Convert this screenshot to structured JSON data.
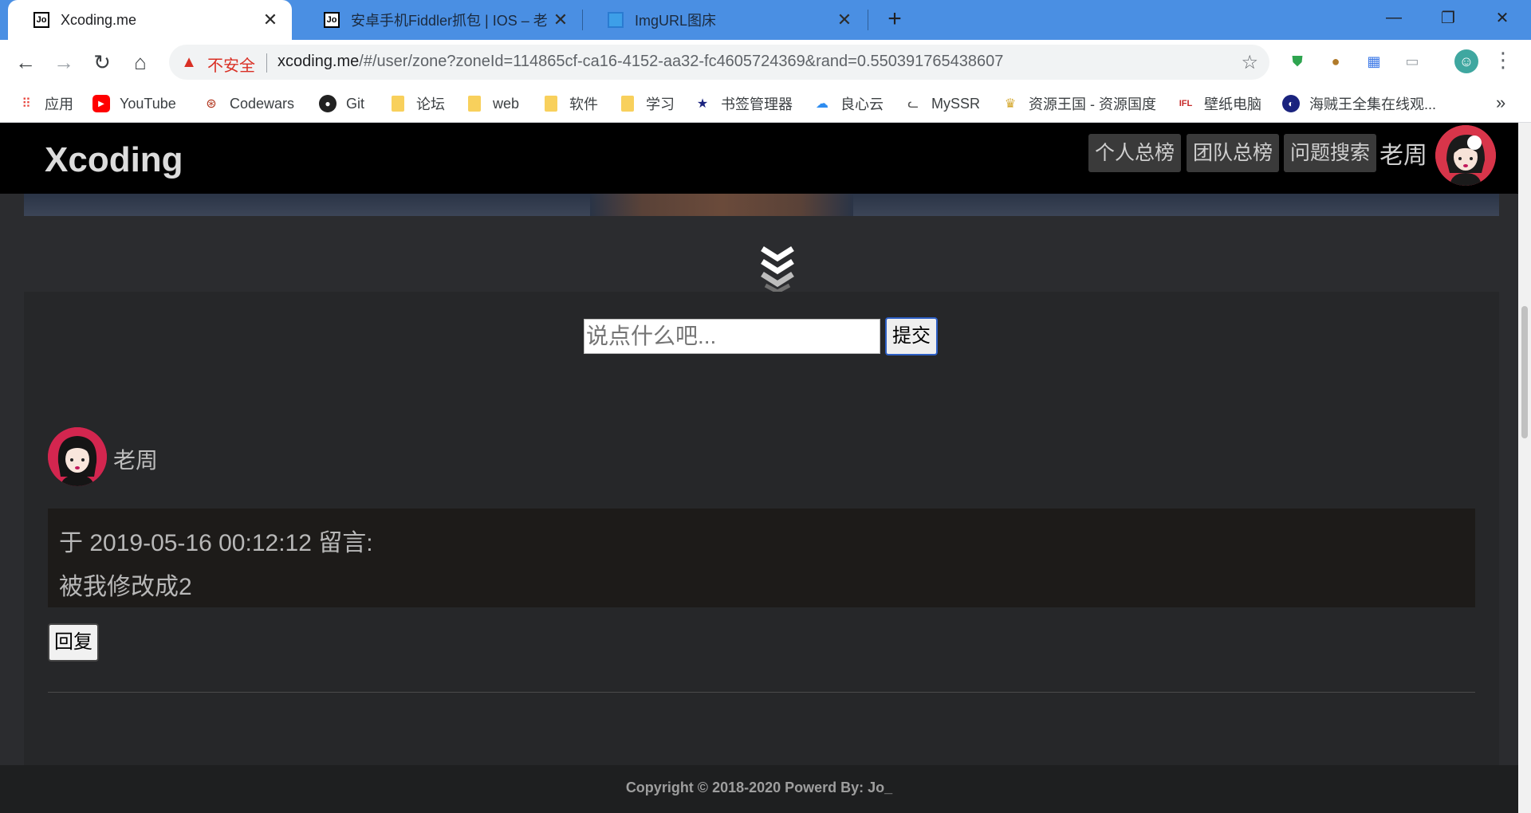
{
  "tabs": [
    {
      "title": "Xcoding.me",
      "active": true,
      "favicon": "jo-favicon-icon"
    },
    {
      "title": "安卓手机Fiddler抓包 | IOS – 老",
      "active": false,
      "favicon": "jo-favicon-icon"
    },
    {
      "title": "ImgURL图床",
      "active": false,
      "favicon": "image-favicon-icon"
    }
  ],
  "window_controls": {
    "minimize": "—",
    "restore": "❐",
    "close": "✕"
  },
  "address": {
    "security_label": "不安全",
    "url_host": "xcoding.me",
    "url_path": "/#/user/zone?zoneId=114865cf-ca16-4152-aa32-fc4605724369&rand=0.550391765438607"
  },
  "bookmarks": [
    {
      "label": "应用",
      "icon": "apps-grid-icon"
    },
    {
      "label": "YouTube",
      "icon": "youtube-icon"
    },
    {
      "label": "Codewars",
      "icon": "codewars-icon"
    },
    {
      "label": "Git",
      "icon": "github-icon"
    },
    {
      "label": "论坛",
      "icon": "folder-icon"
    },
    {
      "label": "web",
      "icon": "folder-icon"
    },
    {
      "label": "软件",
      "icon": "folder-icon"
    },
    {
      "label": "学习",
      "icon": "folder-icon"
    },
    {
      "label": "书签管理器",
      "icon": "star-icon"
    },
    {
      "label": "良心云",
      "icon": "cloud-icon"
    },
    {
      "label": "MySSR",
      "icon": "cat-icon"
    },
    {
      "label": "资源王国 - 资源国度",
      "icon": "crown-icon"
    },
    {
      "label": "壁纸电脑",
      "icon": "ifl-icon"
    },
    {
      "label": "海贼王全集在线观...",
      "icon": "globe-icon"
    }
  ],
  "site": {
    "logo": "Xcoding",
    "nav": [
      "个人总榜",
      "团队总榜",
      "问题搜索"
    ],
    "username": "老周"
  },
  "comment_form": {
    "placeholder": "说点什么吧...",
    "submit_label": "提交"
  },
  "comment": {
    "author": "老周",
    "meta": "于 2019-05-16 00:12:12 留言:",
    "body": "被我修改成2",
    "reply_label": "回复"
  },
  "footer": {
    "copyright": "Copyright © 2018-2020 Powerd By: Jo_"
  },
  "colors": {
    "tab_bar": "#4a8fe3",
    "header": "#000000",
    "page_bg": "#2b2c2f",
    "avatar_red": "#d3264f"
  }
}
